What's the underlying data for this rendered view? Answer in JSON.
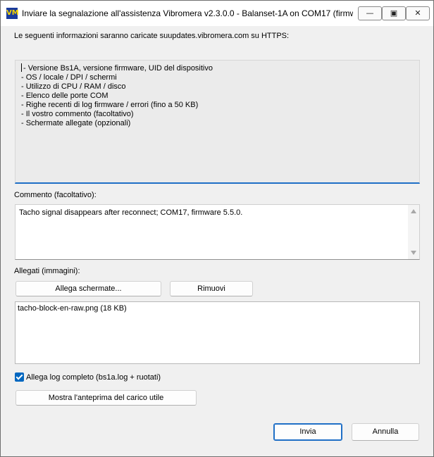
{
  "window": {
    "title": "Inviare la segnalazione all'assistenza Vibromera v2.3.0.0 - Balanset-1A on COM17 (firmw...",
    "icon": "VM",
    "minimize_glyph": "—",
    "maximize_glyph": "▣",
    "close_glyph": "✕"
  },
  "intro_text": "Le seguenti informazioni saranno caricate suupdates.vibromera.com su HTTPS:",
  "info_lines": [
    "- Versione Bs1A, versione firmware, UID del dispositivo",
    "- OS / locale / DPI / schermi",
    "- Utilizzo di CPU / RAM / disco",
    "- Elenco delle porte COM",
    "- Righe recenti di log firmware / errori (fino a 50 KB)",
    "- Il vostro commento (facoltativo)",
    "- Schermate allegate (opzionali)"
  ],
  "comment": {
    "label": "Commento (facoltativo):",
    "value": "Tacho signal disappears after reconnect; COM17, firmware 5.5.0."
  },
  "attachments": {
    "label": "Allegati (immagini):",
    "attach_button": "Allega schermate...",
    "remove_button": "Rimuovi",
    "items": [
      "tacho-block-en-raw.png (18 KB)"
    ]
  },
  "full_log": {
    "label": "Allega log completo (bs1a.log + ruotati)",
    "checked": true
  },
  "preview_button": "Mostra l'anteprima del carico utile",
  "send_button": "Invia",
  "cancel_button": "Annulla",
  "colors": {
    "accent": "#1f6fc6",
    "checkbox": "#0067c0",
    "panel": "#ebebeb"
  }
}
